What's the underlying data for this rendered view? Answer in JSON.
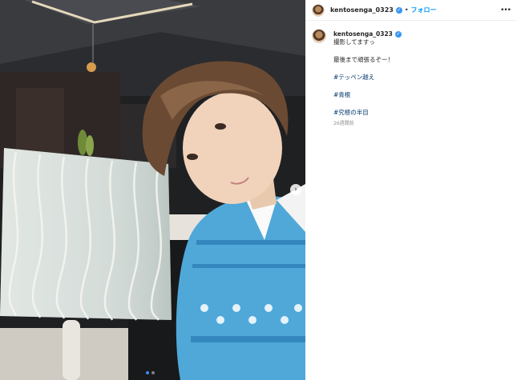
{
  "post": {
    "username": "kentosenga_0323",
    "separator": "•",
    "follow_label": "フォロー",
    "more_icon": "more-horizontal-icon",
    "caption_lines": [
      "撮影してますっ",
      "最後まで頑張るぞー！"
    ],
    "hashtags": [
      "#テッペン越え",
      "#青根",
      "#究極の半目"
    ],
    "timestamp": "26週間前"
  },
  "carousel": {
    "next_icon": "chevron-right-icon",
    "slide_count": 2,
    "active_index": 0
  },
  "colors": {
    "accent": "#0095f6",
    "verified": "#3897f0",
    "hashtag": "#00376b",
    "vest": "#4fa8d8"
  }
}
